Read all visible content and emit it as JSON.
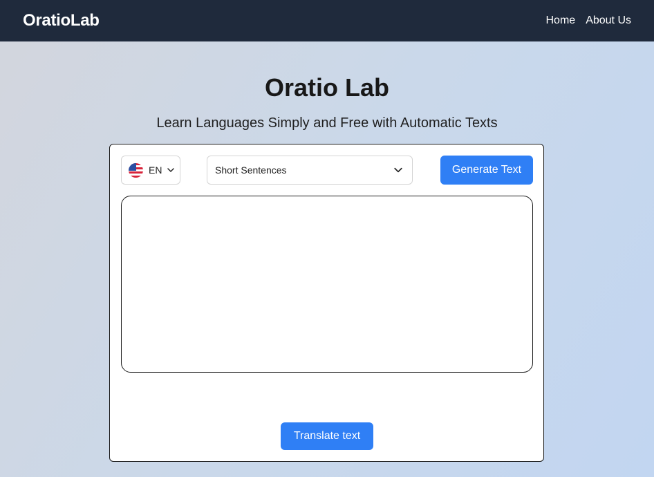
{
  "navbar": {
    "brand": "OratioLab",
    "links": [
      {
        "label": "Home"
      },
      {
        "label": "About Us"
      }
    ]
  },
  "hero": {
    "title": "Oratio Lab",
    "subtitle": "Learn Languages Simply and Free with Automatic Texts"
  },
  "controls": {
    "language": {
      "code": "EN",
      "flag_icon": "us-flag-icon"
    },
    "mode": {
      "selected": "Short Sentences"
    },
    "generate_label": "Generate Text"
  },
  "text_area": {
    "value": ""
  },
  "translate_label": "Translate text",
  "colors": {
    "navbar": "#1f2a3c",
    "accent": "#2f7ff5",
    "background_start": "#d3d6dd",
    "background_end": "#c2d6f1"
  }
}
